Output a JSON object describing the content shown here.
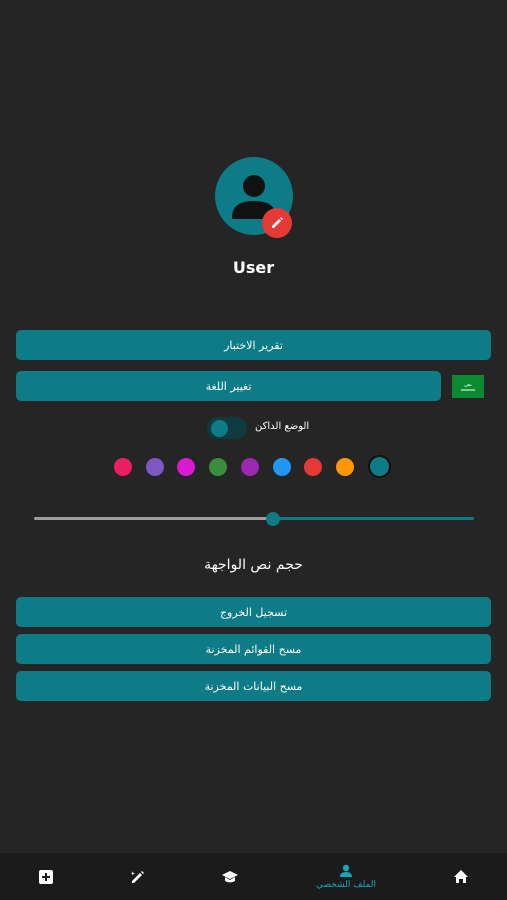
{
  "profile": {
    "username": "User"
  },
  "buttons": {
    "test_report": "تقرير الاختبار",
    "change_language": "تغيير اللغة",
    "logout": "تسجيل الخروج",
    "clear_lists": "مسح القوائم المخزنة",
    "clear_data": "مسح البيانات المخزنة"
  },
  "language_flag": {
    "text": "نص"
  },
  "dark_mode": {
    "label": "الوضع الداكن",
    "enabled": true
  },
  "theme_colors": [
    "#e91e63",
    "#7e57c2",
    "#d81bd0",
    "#388e3c",
    "#9c27b0",
    "#2196f3",
    "#e53935",
    "#ff9800",
    "#0e7c86"
  ],
  "selected_color": "#0e7c86",
  "font_size": {
    "title": "حجم نص الواجهة",
    "slider_value": 0.54
  },
  "bottom_nav": {
    "items": [
      {
        "icon": "add-box-icon",
        "label": ""
      },
      {
        "icon": "pencil-edit-icon",
        "label": ""
      },
      {
        "icon": "graduation-cap-icon",
        "label": ""
      },
      {
        "icon": "person-icon",
        "label": "الملف الشخصي"
      },
      {
        "icon": "home-icon",
        "label": ""
      }
    ],
    "active_index": 3
  },
  "colors": {
    "accent": "#0e7c86",
    "background": "#252525",
    "nav_active": "#14a6b4",
    "edit_badge": "#e53935"
  }
}
